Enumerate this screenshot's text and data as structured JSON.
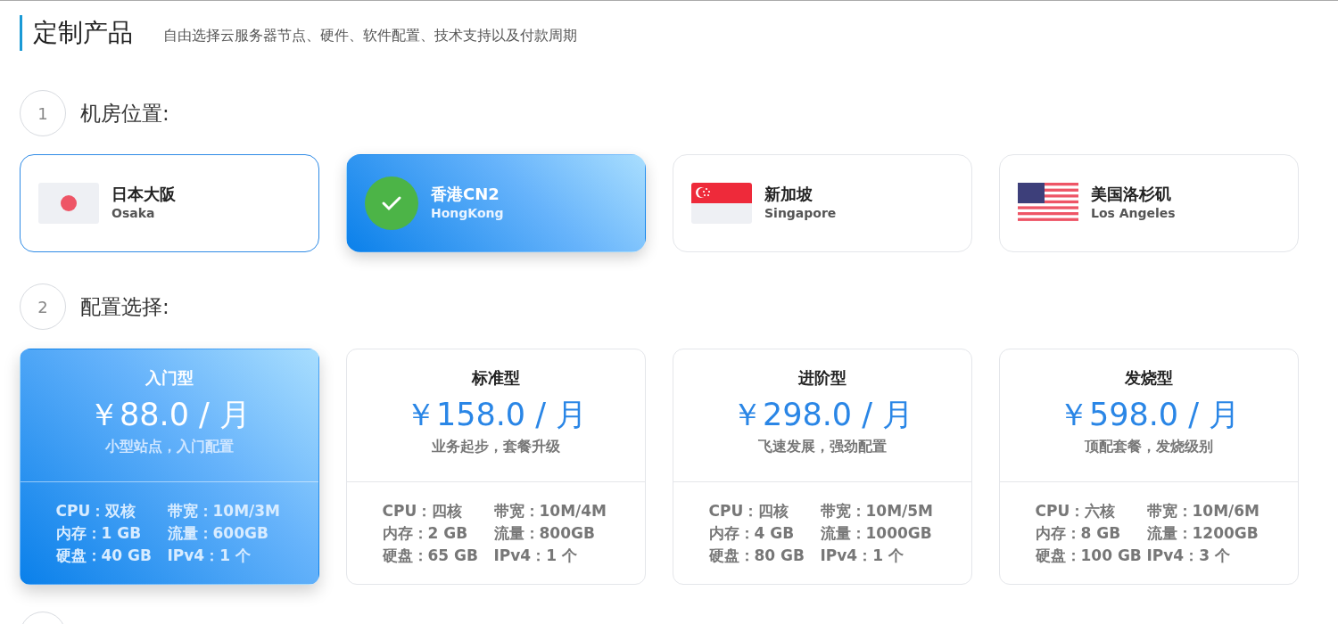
{
  "header": {
    "title": "定制产品",
    "subtitle": "自由选择云服务器节点、硬件、软件配置、技术支持以及付款周期"
  },
  "steps": [
    {
      "number": "1",
      "label": "机房位置:"
    },
    {
      "number": "2",
      "label": "配置选择:"
    }
  ],
  "locations": [
    {
      "name": "日本大阪",
      "sub": "Osaka",
      "selected": false
    },
    {
      "name": "香港CN2",
      "sub": "HongKong",
      "selected": true
    },
    {
      "name": "新加坡",
      "sub": "Singapore",
      "selected": false
    },
    {
      "name": "美国洛杉矶",
      "sub": "Los Angeles",
      "selected": false
    }
  ],
  "plans": [
    {
      "name": "入门型",
      "price": "￥88.0 / 月",
      "tagline": "小型站点，入门配置",
      "selected": true,
      "specs": [
        "CPU：双核",
        "带宽：10M/3M",
        "内存：1 GB",
        "流量：600GB",
        "硬盘：40 GB",
        "IPv4：1 个"
      ]
    },
    {
      "name": "标准型",
      "price": "￥158.0 / 月",
      "tagline": "业务起步，套餐升级",
      "selected": false,
      "specs": [
        "CPU：四核",
        "带宽：10M/4M",
        "内存：2 GB",
        "流量：800GB",
        "硬盘：65 GB",
        "IPv4：1 个"
      ]
    },
    {
      "name": "进阶型",
      "price": "￥298.0 / 月",
      "tagline": "飞速发展，强劲配置",
      "selected": false,
      "specs": [
        "CPU：四核",
        "带宽：10M/5M",
        "内存：4 GB",
        "流量：1000GB",
        "硬盘：80 GB",
        "IPv4：1 个"
      ]
    },
    {
      "name": "发烧型",
      "price": "￥598.0 / 月",
      "tagline": "顶配套餐，发烧级别",
      "selected": false,
      "specs": [
        "CPU：六核",
        "带宽：10M/6M",
        "内存：8 GB",
        "流量：1200GB",
        "硬盘：100 GB",
        "IPv4：3 个"
      ]
    }
  ]
}
